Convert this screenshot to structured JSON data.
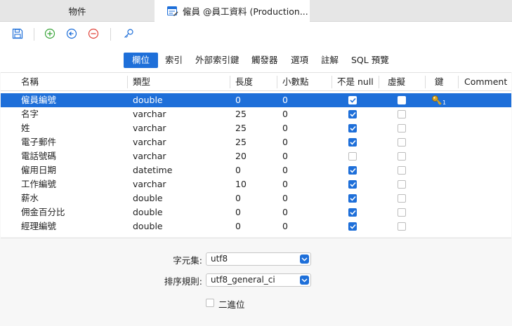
{
  "tabs": {
    "inactive_label": "物件",
    "active_label": "僱員 @員工資料 (Production..."
  },
  "toolbar": {
    "icons": [
      "save-icon",
      "add-icon",
      "back-icon",
      "remove-icon",
      "key-icon"
    ]
  },
  "subtabs": [
    "欄位",
    "索引",
    "外部索引鍵",
    "觸發器",
    "選項",
    "註解",
    "SQL 預覽"
  ],
  "columns": [
    "名稱",
    "類型",
    "長度",
    "小數點",
    "不是 null",
    "虛擬",
    "鍵",
    "Comment"
  ],
  "rows": [
    {
      "name": "僱員編號",
      "type": "double",
      "length": "0",
      "decimals": "0",
      "notnull": true,
      "virtual": false,
      "key": "1",
      "selected": true
    },
    {
      "name": "名字",
      "type": "varchar",
      "length": "25",
      "decimals": "0",
      "notnull": true,
      "virtual": false,
      "key": "",
      "selected": false
    },
    {
      "name": "姓",
      "type": "varchar",
      "length": "25",
      "decimals": "0",
      "notnull": true,
      "virtual": false,
      "key": "",
      "selected": false
    },
    {
      "name": "電子郵件",
      "type": "varchar",
      "length": "25",
      "decimals": "0",
      "notnull": true,
      "virtual": false,
      "key": "",
      "selected": false
    },
    {
      "name": "電話號碼",
      "type": "varchar",
      "length": "20",
      "decimals": "0",
      "notnull": false,
      "virtual": false,
      "key": "",
      "selected": false
    },
    {
      "name": "僱用日期",
      "type": "datetime",
      "length": "0",
      "decimals": "0",
      "notnull": true,
      "virtual": false,
      "key": "",
      "selected": false
    },
    {
      "name": "工作編號",
      "type": "varchar",
      "length": "10",
      "decimals": "0",
      "notnull": true,
      "virtual": false,
      "key": "",
      "selected": false
    },
    {
      "name": "薪水",
      "type": "double",
      "length": "0",
      "decimals": "0",
      "notnull": true,
      "virtual": false,
      "key": "",
      "selected": false
    },
    {
      "name": "佣金百分比",
      "type": "double",
      "length": "0",
      "decimals": "0",
      "notnull": true,
      "virtual": false,
      "key": "",
      "selected": false
    },
    {
      "name": "經理編號",
      "type": "double",
      "length": "0",
      "decimals": "0",
      "notnull": true,
      "virtual": false,
      "key": "",
      "selected": false
    }
  ],
  "form": {
    "charset_label": "字元集:",
    "charset_value": "utf8",
    "collation_label": "排序規則:",
    "collation_value": "utf8_general_ci",
    "binary_label": "二進位",
    "binary_checked": false
  },
  "colors": {
    "accent": "#1e6fd9",
    "key_icon": "#d9a21b"
  }
}
